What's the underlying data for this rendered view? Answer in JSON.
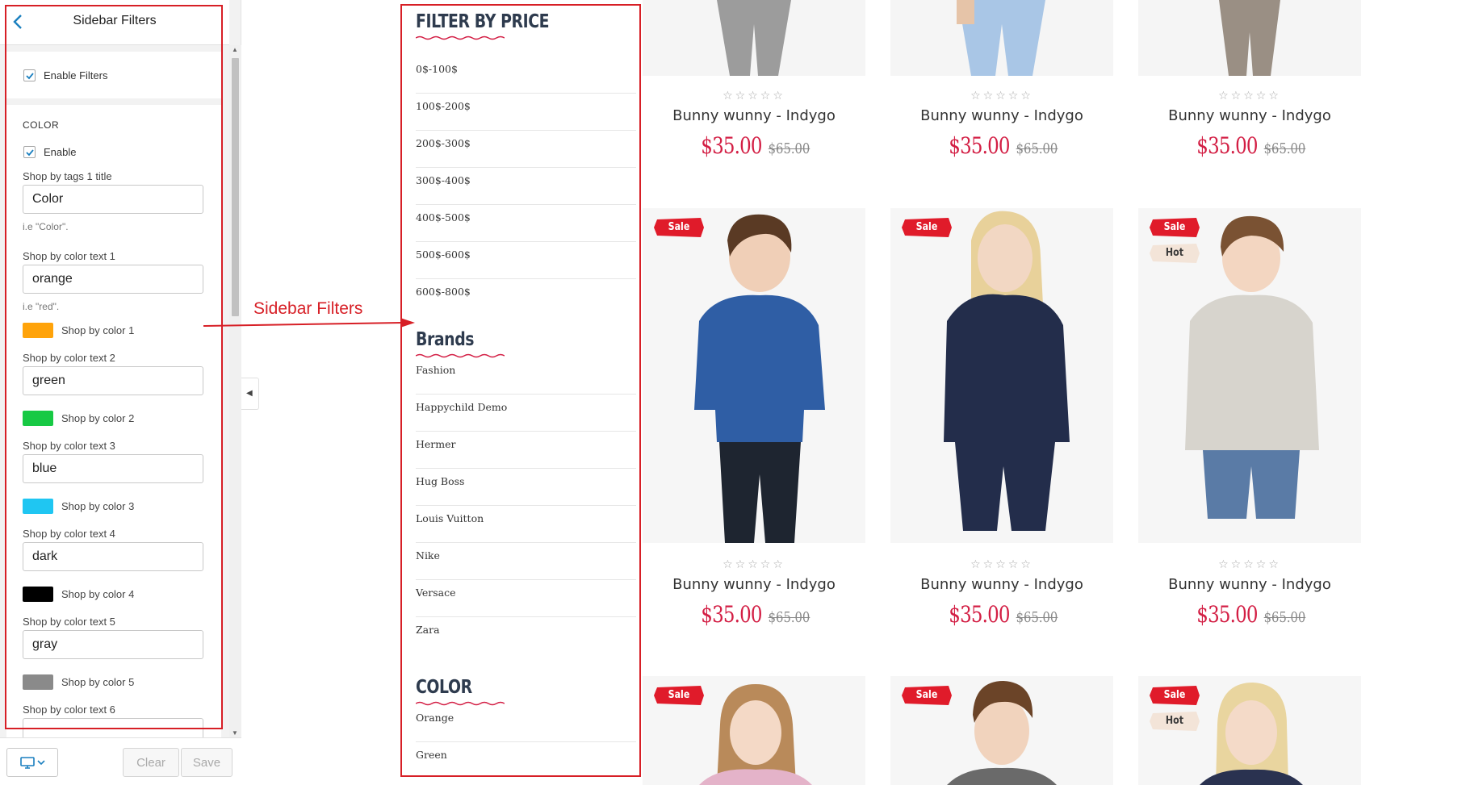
{
  "settings": {
    "title": "Sidebar Filters",
    "enable_filters_label": "Enable Filters",
    "color_section_title": "COLOR",
    "enable_label": "Enable",
    "tags_title_label": "Shop by tags 1 title",
    "tags_title_value": "Color",
    "tags_title_hint": "i.e \"Color\".",
    "colors": [
      {
        "text_label": "Shop by color text 1",
        "text_value": "orange",
        "hint": "i.e \"red\".",
        "swatch_label": "Shop by color 1",
        "swatch_color": "#ffa30a"
      },
      {
        "text_label": "Shop by color text 2",
        "text_value": "green",
        "hint": "",
        "swatch_label": "Shop by color 2",
        "swatch_color": "#17c944"
      },
      {
        "text_label": "Shop by color text 3",
        "text_value": "blue",
        "hint": "",
        "swatch_label": "Shop by color 3",
        "swatch_color": "#1fc6f2"
      },
      {
        "text_label": "Shop by color text 4",
        "text_value": "dark",
        "hint": "",
        "swatch_label": "Shop by color 4",
        "swatch_color": "#000000"
      },
      {
        "text_label": "Shop by color text 5",
        "text_value": "gray",
        "hint": "",
        "swatch_label": "Shop by color 5",
        "swatch_color": "#8a8a8a"
      }
    ],
    "next_text_label": "Shop by color text 6",
    "clear_label": "Clear",
    "save_label": "Save"
  },
  "annotation": {
    "label": "Sidebar Filters",
    "color": "#d71f26"
  },
  "store_sidebar": {
    "price_title": "FILTER BY PRICE",
    "price_items": [
      "0$-100$",
      "100$-200$",
      "200$-300$",
      "300$-400$",
      "400$-500$",
      "500$-600$",
      "600$-800$"
    ],
    "brands_title": "Brands",
    "brand_items": [
      "Fashion",
      "Happychild Demo",
      "Hermer",
      "Hug Boss",
      "Louis Vuitton",
      "Nike",
      "Versace",
      "Zara"
    ],
    "color_title": "COLOR",
    "color_items": [
      "Orange",
      "Green"
    ]
  },
  "products": {
    "rows": [
      [
        {
          "name": "Bunny wunny - Indygo",
          "price": "$35.00",
          "old_price": "$65.00",
          "badges": []
        },
        {
          "name": "Bunny wunny - Indygo",
          "price": "$35.00",
          "old_price": "$65.00",
          "badges": []
        },
        {
          "name": "Bunny wunny - Indygo",
          "price": "$35.00",
          "old_price": "$65.00",
          "badges": []
        }
      ],
      [
        {
          "name": "Bunny wunny - Indygo",
          "price": "$35.00",
          "old_price": "$65.00",
          "badges": [
            "Sale"
          ]
        },
        {
          "name": "Bunny wunny - Indygo",
          "price": "$35.00",
          "old_price": "$65.00",
          "badges": [
            "Sale"
          ]
        },
        {
          "name": "Bunny wunny - Indygo",
          "price": "$35.00",
          "old_price": "$65.00",
          "badges": [
            "Sale",
            "Hot"
          ]
        }
      ],
      [
        {
          "badges": [
            "Sale"
          ]
        },
        {
          "badges": [
            "Sale"
          ]
        },
        {
          "badges": [
            "Sale",
            "Hot"
          ]
        }
      ]
    ],
    "stars": "☆☆☆☆☆",
    "price_color": "#d31e44",
    "sale_badge_color": "#e01b2a",
    "hot_badge_color": "#f3e4d8"
  }
}
